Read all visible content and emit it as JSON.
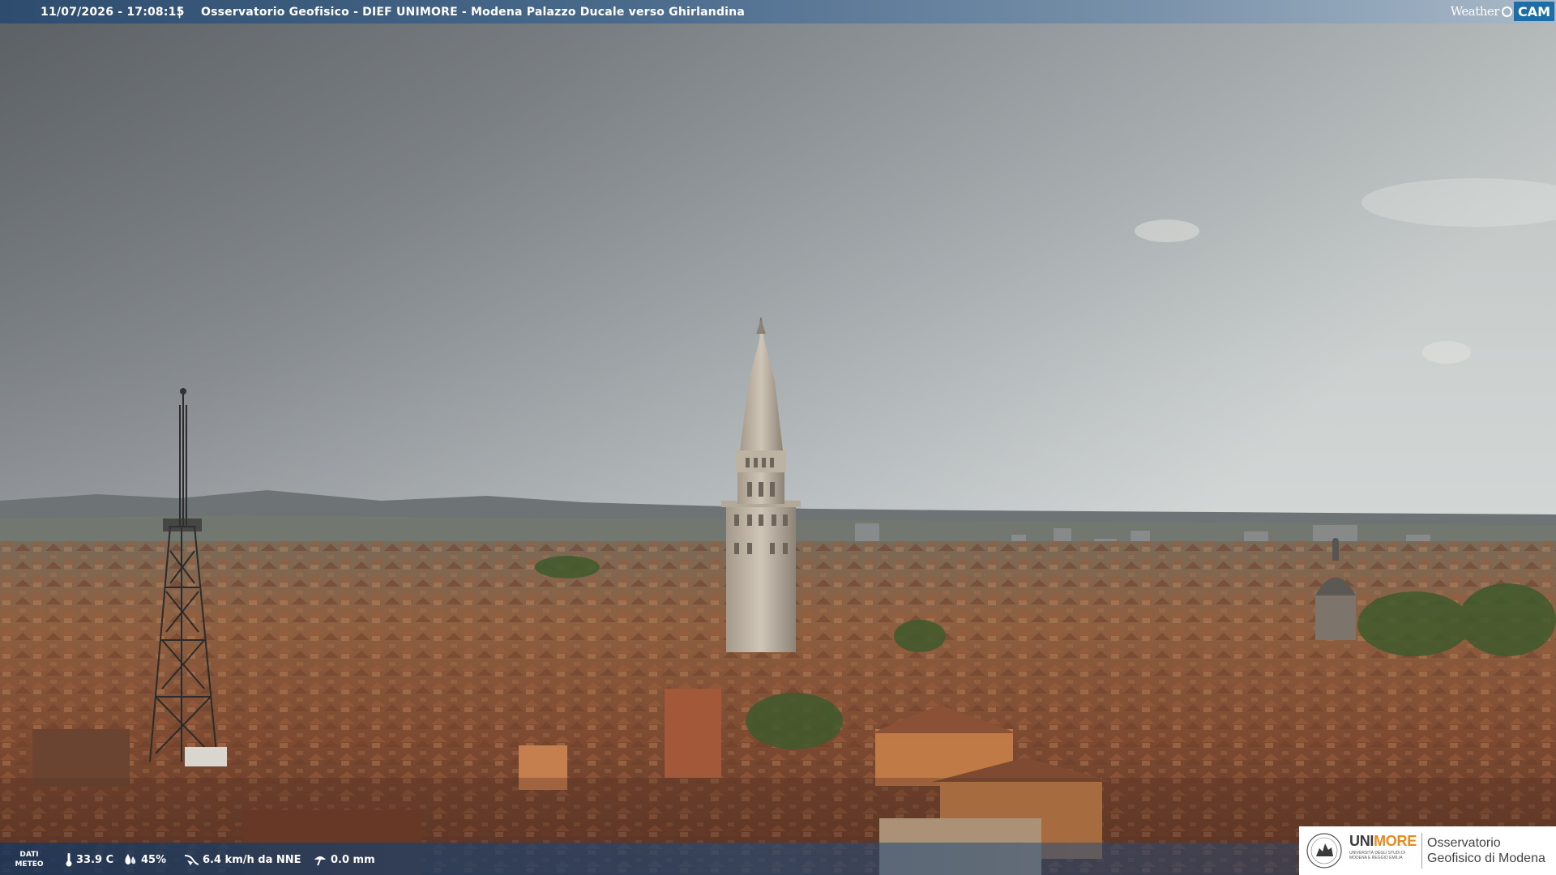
{
  "header": {
    "datetime": "11/07/2026 - 17:08:15",
    "separator": "|",
    "title": "Osservatorio Geofisico - DIEF UNIMORE - Modena Palazzo Ducale verso Ghirlandina",
    "brand_part1": "Weather",
    "brand_part2": "CAM",
    "brand_color": "#1d6ea6"
  },
  "meteo": {
    "label": "DATI METEO",
    "temperature": "33.9 C",
    "humidity": "45%",
    "wind": "6.4 km/h da NNE",
    "rain": "0.0 mm",
    "icons": [
      "thermometer-icon",
      "humidity-drops-icon",
      "wind-icon",
      "rain-gauge-icon"
    ]
  },
  "logo": {
    "uni_part1": "UNI",
    "uni_part2": "MORE",
    "uni_subtitle": "UNIVERSITÀ DEGLI STUDI DI MODENA E REGGIO EMILIA",
    "observatory": "Osservatorio Geofisico di Modena",
    "accent": "#e8891d"
  }
}
